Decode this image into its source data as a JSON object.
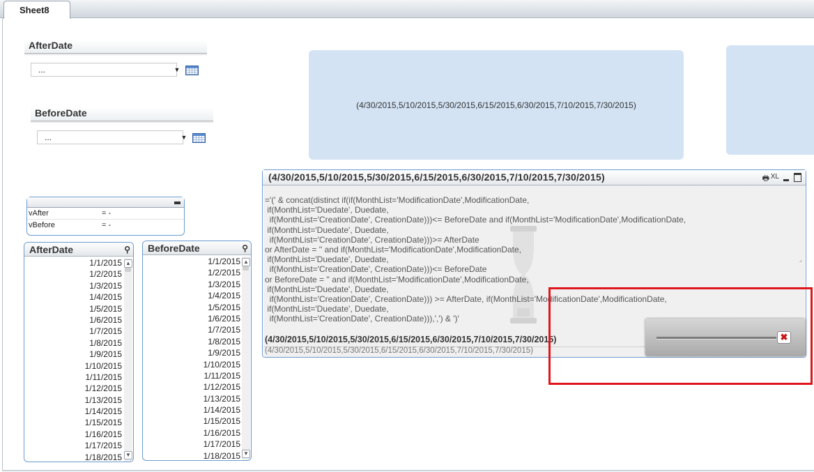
{
  "tabs": [
    {
      "label": "Sheet8"
    }
  ],
  "input_after": {
    "title": "AfterDate",
    "value": "..."
  },
  "input_before": {
    "title": "BeforeDate",
    "value": "..."
  },
  "text_object": {
    "text": "(4/30/2015,5/10/2015,5/30/2015,6/15/2015,6/30/2015,7/10/2015,7/30/2015)"
  },
  "variables": {
    "rows": [
      {
        "name": "vAfter",
        "value": "= -"
      },
      {
        "name": "vBefore",
        "value": "= -"
      }
    ]
  },
  "listbox_after": {
    "title": "AfterDate",
    "items": [
      "1/1/2015",
      "1/2/2015",
      "1/3/2015",
      "1/4/2015",
      "1/5/2015",
      "1/6/2015",
      "1/7/2015",
      "1/8/2015",
      "1/9/2015",
      "1/10/2015",
      "1/11/2015",
      "1/12/2015",
      "1/13/2015",
      "1/14/2015",
      "1/15/2015",
      "1/16/2015",
      "1/17/2015",
      "1/18/2015"
    ]
  },
  "listbox_before": {
    "title": "BeforeDate",
    "items": [
      "1/1/2015",
      "1/2/2015",
      "1/3/2015",
      "1/4/2015",
      "1/5/2015",
      "1/6/2015",
      "1/7/2015",
      "1/8/2015",
      "1/9/2015",
      "1/10/2015",
      "1/11/2015",
      "1/12/2015",
      "1/13/2015",
      "1/14/2015",
      "1/15/2015",
      "1/16/2015",
      "1/17/2015",
      "1/18/2015"
    ]
  },
  "table_object": {
    "title": "(4/30/2015,5/10/2015,5/30/2015,6/15/2015,6/30/2015,7/10/2015,7/30/2015)",
    "header_icons": {
      "print": "print-icon",
      "xl": "XL",
      "minimize": "minimize-icon",
      "maximize": "maximize-icon"
    },
    "expression_lines": [
      "='(' & concat(distinct if(if(MonthList='ModificationDate',ModificationDate,",
      " if(MonthList='Duedate', Duedate,",
      "  if(MonthList='CreationDate', CreationDate)))<= BeforeDate and if(MonthList='ModificationDate',ModificationDate,",
      " if(MonthList='Duedate', Duedate,",
      "  if(MonthList='CreationDate', CreationDate)))>= AfterDate",
      "or AfterDate = '' and if(MonthList='ModificationDate',ModificationDate,",
      " if(MonthList='Duedate', Duedate,",
      "  if(MonthList='CreationDate', CreationDate)))<= BeforeDate",
      "or BeforeDate = '' and if(MonthList='ModificationDate',ModificationDate,",
      " if(MonthList='Duedate', Duedate,",
      "  if(MonthList='CreationDate', CreationDate))) >= AfterDate, if(MonthList='ModificationDate',ModificationDate,",
      " if(MonthList='Duedate', Duedate,",
      "  if(MonthList='CreationDate', CreationDate))),',') & ')'"
    ],
    "result_bold": "(4/30/2015,5/10/2015,5/30/2015,6/15/2015,6/30/2015,7/10/2015,7/30/2015)",
    "result_plain": "(4/30/2015,5/10/2015,5/30/2015,6/15/2015,6/30/2015,7/10/2015,7/30/2015)"
  },
  "progress": {
    "cancel_icon": "close-icon",
    "cancel_label": "✖"
  },
  "colors": {
    "accent": "#6b9bd1",
    "text_box_bg": "#d3e3f4",
    "highlight": "#e0151b",
    "cancel": "#c81414"
  }
}
